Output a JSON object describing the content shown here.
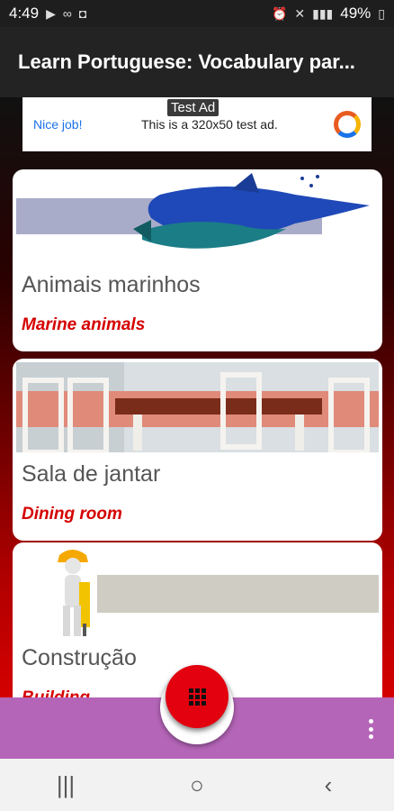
{
  "status_bar": {
    "time": "4:49",
    "left_icons": [
      "play-icon",
      "voicemail-icon",
      "camera-icon"
    ],
    "battery": "49%"
  },
  "app_bar": {
    "title": "Learn Portuguese: Vocabulary par..."
  },
  "ad": {
    "label": "Test Ad",
    "nice_job": "Nice job!",
    "text": "This is a 320x50 test ad."
  },
  "cards": [
    {
      "portuguese": "Animais marinhos",
      "english": "Marine animals",
      "image": "dolphins-image"
    },
    {
      "portuguese": "Sala de jantar",
      "english": "Dining room",
      "image": "dining-room-image"
    },
    {
      "portuguese": "Construção",
      "english": "Building",
      "image": "construction-worker-image"
    }
  ],
  "nav_bar": {
    "recents": "|||",
    "home": "○",
    "back": "‹"
  },
  "colors": {
    "accent_red": "#d50000",
    "fab_red": "#e3000f",
    "bottom_bar": "#b565b8"
  }
}
